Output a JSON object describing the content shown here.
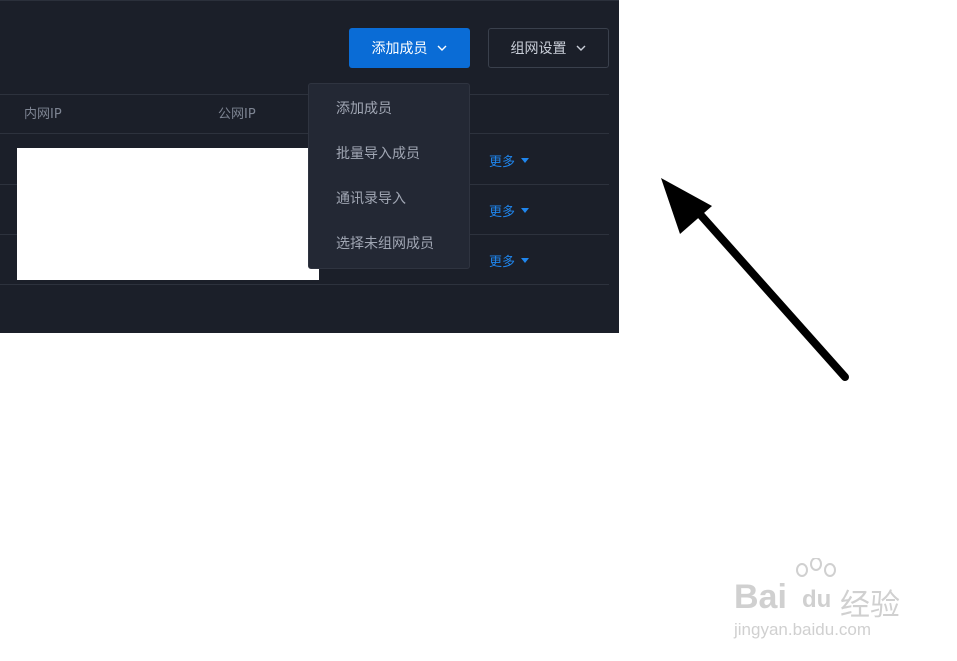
{
  "toolbar": {
    "add_member_label": "添加成员",
    "network_settings_label": "组网设置"
  },
  "table": {
    "columns": [
      "内网IP",
      "公网IP"
    ],
    "rows": [
      {
        "more_label": "更多"
      },
      {
        "more_label": "更多"
      },
      {
        "more_label": "更多"
      }
    ]
  },
  "dropdown": {
    "items": [
      "添加成员",
      "批量导入成员",
      "通讯录导入",
      "选择未组网成员"
    ]
  },
  "watermark": {
    "brand": "Bai",
    "brand2": "du",
    "product": "经验",
    "url": "jingyan.baidu.com"
  },
  "colors": {
    "panel_bg": "#1b1f29",
    "accent": "#0a6cd6",
    "link": "#1f86ee"
  }
}
